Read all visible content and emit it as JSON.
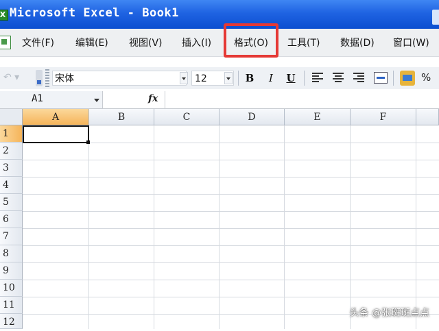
{
  "window": {
    "title": "Microsoft Excel - Book1",
    "app_icon": "X"
  },
  "menu": {
    "items": [
      {
        "label": "文件(F)"
      },
      {
        "label": "编辑(E)"
      },
      {
        "label": "视图(V)"
      },
      {
        "label": "插入(I)"
      },
      {
        "label": "格式(O)"
      },
      {
        "label": "工具(T)"
      },
      {
        "label": "数据(D)"
      },
      {
        "label": "窗口(W)"
      }
    ],
    "highlighted_item": "格式(O)",
    "highlight_color": "#e53935"
  },
  "toolbar": {
    "font_name": "宋体",
    "font_size": "12",
    "bold_label": "B",
    "italic_label": "I",
    "underline_label": "U",
    "percent_label": "%"
  },
  "formula_bar": {
    "name_box": "A1",
    "fx_label": "fx",
    "formula": ""
  },
  "sheet": {
    "columns": [
      "A",
      "B",
      "C",
      "D",
      "E",
      "F"
    ],
    "rows": [
      "1",
      "2",
      "3",
      "4",
      "5",
      "6",
      "7",
      "8",
      "9",
      "10",
      "11",
      "12"
    ],
    "active_cell": "A1"
  },
  "watermark": "头条 @张斑斑点点",
  "colors": {
    "title_bar": "#1f63e2",
    "active_header": "#f5b45a"
  }
}
